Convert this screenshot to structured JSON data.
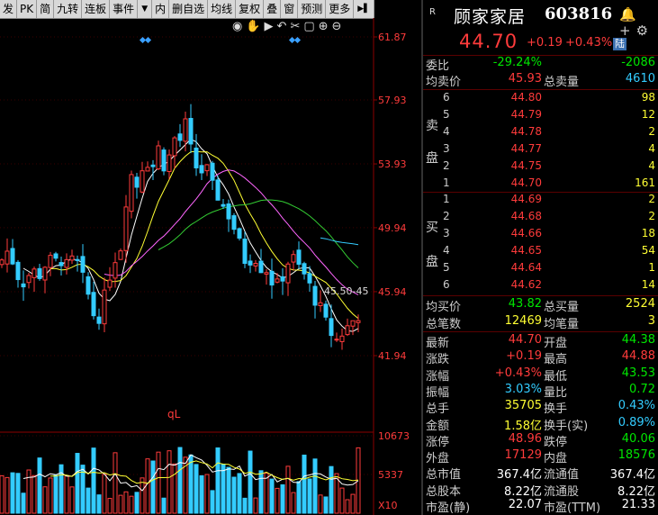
{
  "toolbar": {
    "items": [
      "发",
      "PK",
      "简",
      "九转",
      "连板",
      "事件"
    ],
    "items2": [
      "内",
      "删自选",
      "均线",
      "复权",
      "叠",
      "窗",
      "预测",
      "更多"
    ],
    "arrow_label": "▼",
    "play_label": "▶▌"
  },
  "chart": {
    "price_ticks": [
      "61.87",
      "57.93",
      "53.93",
      "49.94",
      "45.94",
      "41.94"
    ],
    "volume_ticks": [
      "10673",
      "5337",
      "X10"
    ],
    "annotation": "45.50-45",
    "indicator_label": "qL",
    "up_color": "#ff3b3b",
    "down_color": "#33ccff"
  },
  "stock": {
    "badge": "R",
    "name": "顾家家居",
    "code": "603816",
    "price": "44.70",
    "change": "+0.19",
    "change_pct": "+0.43%",
    "market_tag": "陆"
  },
  "summary": [
    {
      "label": "委比",
      "value": "-29.24%",
      "value_color": "green",
      "value2": "-2086",
      "value2_color": "green"
    },
    {
      "label": "均卖价",
      "value": "45.93",
      "value_color": "red",
      "label2": "总卖量",
      "value2": "4610",
      "value2_color": "cyan"
    }
  ],
  "sell_label_top": "卖",
  "sell_label_bottom": "盘",
  "buy_label_top": "买",
  "buy_label_bottom": "盘",
  "sell_orders": [
    {
      "idx": "6",
      "price": "44.80",
      "vol": "98"
    },
    {
      "idx": "5",
      "price": "44.79",
      "vol": "12"
    },
    {
      "idx": "4",
      "price": "44.78",
      "vol": "2"
    },
    {
      "idx": "3",
      "price": "44.77",
      "vol": "4"
    },
    {
      "idx": "2",
      "price": "44.75",
      "vol": "4"
    },
    {
      "idx": "1",
      "price": "44.70",
      "vol": "161"
    }
  ],
  "buy_orders": [
    {
      "idx": "1",
      "price": "44.69",
      "vol": "2"
    },
    {
      "idx": "2",
      "price": "44.68",
      "vol": "2"
    },
    {
      "idx": "3",
      "price": "44.66",
      "vol": "18"
    },
    {
      "idx": "4",
      "price": "44.65",
      "vol": "54"
    },
    {
      "idx": "5",
      "price": "44.64",
      "vol": "1"
    },
    {
      "idx": "6",
      "price": "44.62",
      "vol": "14"
    }
  ],
  "bid_summary": [
    {
      "label": "均买价",
      "value": "43.82",
      "value_color": "green",
      "label2": "总买量",
      "value2": "2524",
      "value2_color": "yellow"
    },
    {
      "label": "总笔数",
      "value": "12469",
      "value_color": "yellow",
      "label2": "均笔量",
      "value2": "3",
      "value2_color": "yellow"
    }
  ],
  "quote": [
    {
      "l1": "最新",
      "v1": "44.70",
      "c1": "red",
      "l2": "开盘",
      "v2": "44.38",
      "c2": "green"
    },
    {
      "l1": "涨跌",
      "v1": "+0.19",
      "c1": "red",
      "l2": "最高",
      "v2": "44.88",
      "c2": "red"
    },
    {
      "l1": "涨幅",
      "v1": "+0.43%",
      "c1": "red",
      "l2": "最低",
      "v2": "43.53",
      "c2": "green"
    },
    {
      "l1": "振幅",
      "v1": "3.03%",
      "c1": "cyan",
      "l2": "量比",
      "v2": "0.72",
      "c2": "green"
    },
    {
      "l1": "总手",
      "v1": "35705",
      "c1": "yellow",
      "l2": "换手",
      "v2": "0.43%",
      "c2": "cyan"
    },
    {
      "l1": "金额",
      "v1": "1.58亿",
      "c1": "yellow",
      "l2": "换手(实)",
      "v2": "0.89%",
      "c2": "cyan"
    },
    {
      "l1": "涨停",
      "v1": "48.96",
      "c1": "red",
      "l2": "跌停",
      "v2": "40.06",
      "c2": "green"
    },
    {
      "l1": "外盘",
      "v1": "17129",
      "c1": "red",
      "l2": "内盘",
      "v2": "18576",
      "c2": "green"
    },
    {
      "l1": "总市值",
      "v1": "367.4亿",
      "c1": "white",
      "l2": "流通值",
      "v2": "367.4亿",
      "c2": "white"
    },
    {
      "l1": "总股本",
      "v1": "8.22亿",
      "c1": "white",
      "l2": "流通股",
      "v2": "8.22亿",
      "c2": "white"
    },
    {
      "l1": "市盈(静)",
      "v1": "22.07",
      "c1": "white",
      "l2": "市盈(TTM)",
      "v2": "21.33",
      "c2": "white"
    }
  ]
}
